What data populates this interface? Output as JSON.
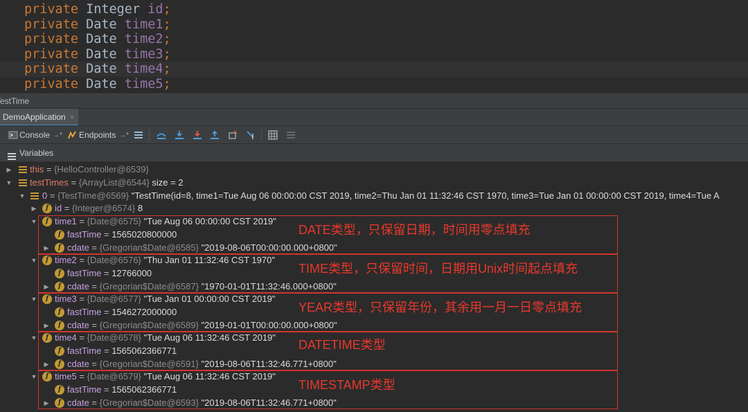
{
  "editor": {
    "lines": [
      {
        "kw": "private",
        "type": "Integer",
        "field": "id"
      },
      {
        "kw": "private",
        "type": "Date",
        "field": "time1"
      },
      {
        "kw": "private",
        "type": "Date",
        "field": "time2"
      },
      {
        "kw": "private",
        "type": "Date",
        "field": "time3"
      },
      {
        "kw": "private",
        "type": "Date",
        "field": "time4"
      },
      {
        "kw": "private",
        "type": "Date",
        "field": "time5"
      }
    ],
    "semicolon": ";"
  },
  "breadcrumb": "TestTime",
  "debug_tab": {
    "label": "DemoApplication",
    "close": "×"
  },
  "toolbar": {
    "console_label": "Console",
    "endpoints_label": "Endpoints",
    "pin_glyph": "→*"
  },
  "variables_header": "Variables",
  "tree": {
    "this": {
      "name": "this",
      "eq": " = ",
      "ref": "{HelloController@6539}"
    },
    "testTimes": {
      "name": "testTimes",
      "eq": " = ",
      "ref": "{ArrayList@6544}",
      "extra": "  size = 2"
    },
    "item0": {
      "name": "0",
      "eq": " = ",
      "ref": "{TestTime@6569}",
      "value": " \"TestTime(id=8, time1=Tue Aug 06 00:00:00 CST 2019, time2=Thu Jan 01 11:32:46 CST 1970, time3=Tue Jan 01 00:00:00 CST 2019, time4=Tue A"
    },
    "id": {
      "name": "id",
      "eq": " = ",
      "ref": "{Integer@6574}",
      "value": " 8"
    },
    "times": [
      {
        "name": "time1",
        "ref": "{Date@6575}",
        "value": " \"Tue Aug 06 00:00:00 CST 2019\"",
        "fastTime": "1565020800000",
        "cdate_ref": "{Gregorian$Date@6585}",
        "cdate_value": " \"2019-08-06T00:00:00.000+0800\"",
        "note": "DATE类型，只保留日期，时间用零点填充"
      },
      {
        "name": "time2",
        "ref": "{Date@6576}",
        "value": " \"Thu Jan 01 11:32:46 CST 1970\"",
        "fastTime": "12766000",
        "cdate_ref": "{Gregorian$Date@6587}",
        "cdate_value": " \"1970-01-01T11:32:46.000+0800\"",
        "note": "TIME类型，只保留时间，日期用Unix时间起点填充"
      },
      {
        "name": "time3",
        "ref": "{Date@6577}",
        "value": " \"Tue Jan 01 00:00:00 CST 2019\"",
        "fastTime": "1546272000000",
        "cdate_ref": "{Gregorian$Date@6589}",
        "cdate_value": " \"2019-01-01T00:00:00.000+0800\"",
        "note": "YEAR类型，只保留年份，其余用一月一日零点填充"
      },
      {
        "name": "time4",
        "ref": "{Date@6578}",
        "value": " \"Tue Aug 06 11:32:46 CST 2019\"",
        "fastTime": "1565062366771",
        "cdate_ref": "{Gregorian$Date@6591}",
        "cdate_value": " \"2019-08-06T11:32:46.771+0800\"",
        "note": "DATETIME类型"
      },
      {
        "name": "time5",
        "ref": "{Date@6579}",
        "value": " \"Tue Aug 06 11:32:46 CST 2019\"",
        "fastTime": "1565062366771",
        "cdate_ref": "{Gregorian$Date@6593}",
        "cdate_value": " \"2019-08-06T11:32:46.771+0800\"",
        "note": "TIMESTAMP类型"
      }
    ],
    "fastTime_label": "fastTime",
    "cdate_label": "cdate",
    "eq": " = "
  },
  "colors": {
    "accent_red": "#d0352b",
    "keyword": "#cc7832",
    "field": "#9876aa"
  }
}
